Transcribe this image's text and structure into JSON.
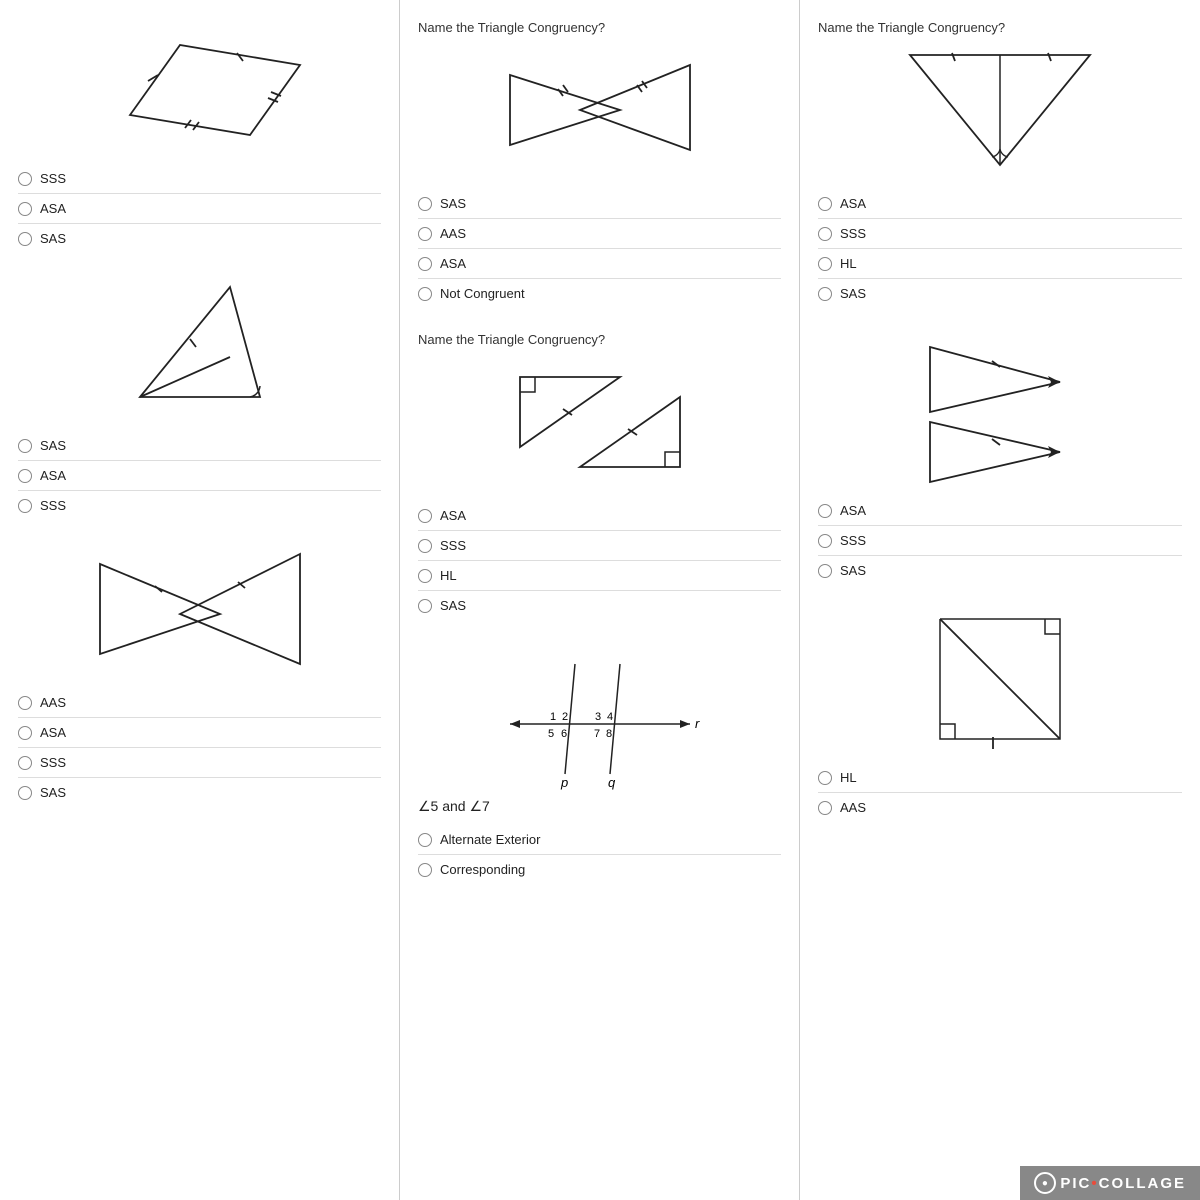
{
  "col1": {
    "questions": [
      {
        "id": "q1",
        "diagram": "parallelogram_tick",
        "options": [
          "SSS",
          "ASA",
          "SAS"
        ]
      },
      {
        "id": "q2",
        "diagram": "triangle_angle",
        "options": [
          "SAS",
          "ASA",
          "SSS"
        ]
      },
      {
        "id": "q3",
        "diagram": "bowtie_cross",
        "options": [
          "AAS",
          "ASA",
          "SSS",
          "SAS"
        ]
      }
    ]
  },
  "col2": {
    "questions": [
      {
        "id": "q4",
        "label": "Name the Triangle Congruency?",
        "diagram": "bowtie_mark",
        "options": [
          "SAS",
          "AAS",
          "ASA",
          "Not Congruent"
        ]
      },
      {
        "id": "q5",
        "label": "Name the Triangle Congruency?",
        "diagram": "right_triangle_cross",
        "options": [
          "ASA",
          "SSS",
          "HL",
          "SAS"
        ]
      },
      {
        "id": "q6",
        "label": "angle_diagram",
        "diagram": "angle_lines",
        "angle_text": "∠5 and ∠7",
        "options": [
          "Alternate Exterior",
          "Corresponding"
        ]
      }
    ]
  },
  "col3": {
    "questions": [
      {
        "id": "q7",
        "label": "Name the Triangle Congruency?",
        "diagram": "big_triangle_tick",
        "options": [
          "ASA",
          "SSS",
          "HL",
          "SAS"
        ]
      },
      {
        "id": "q8",
        "diagram": "arrow_triangles",
        "options": [
          "ASA",
          "SSS",
          "SAS"
        ]
      },
      {
        "id": "q9",
        "diagram": "right_triangle_box",
        "options": [
          "HL",
          "AAS"
        ]
      }
    ]
  },
  "watermark": {
    "text": "PIC·COLLAGE",
    "dot": "·"
  }
}
